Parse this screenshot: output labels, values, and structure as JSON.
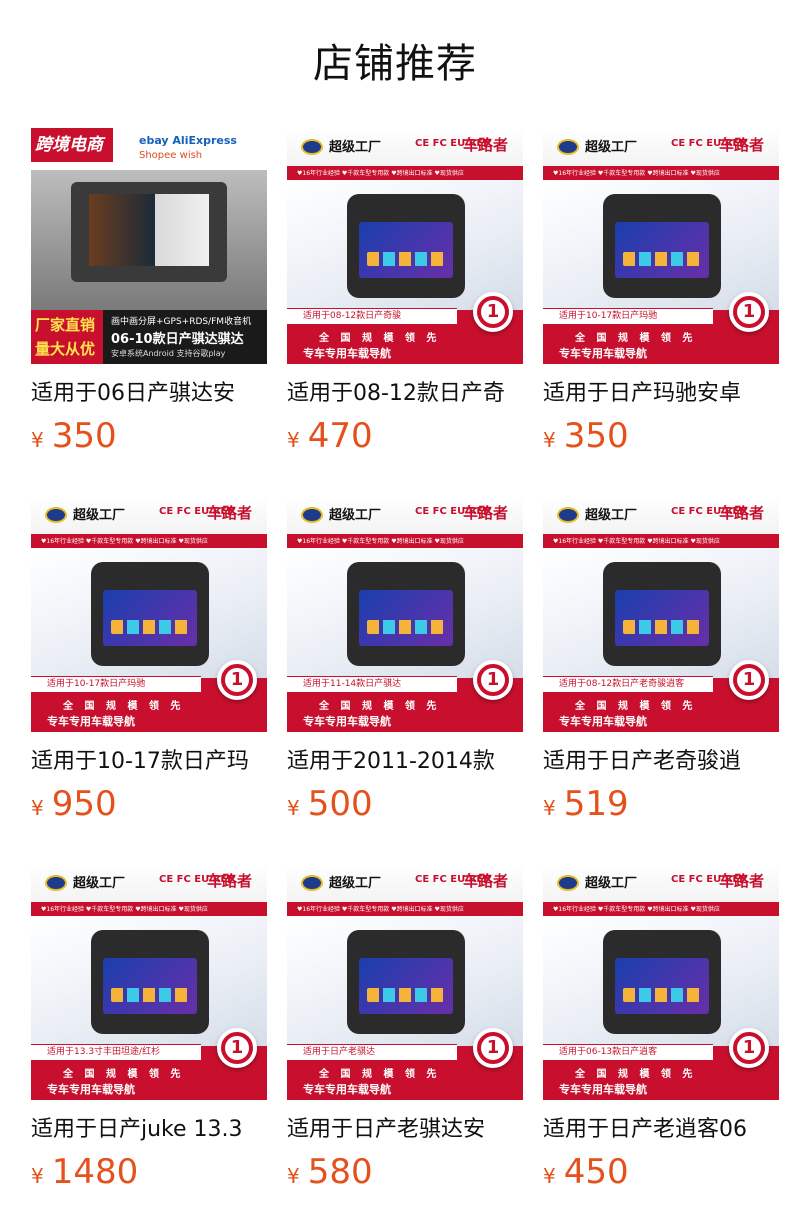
{
  "header": {
    "title": "店铺推荐"
  },
  "currency": "¥",
  "thumb_template": {
    "logo": "超级工厂",
    "certs": "CE FC EU REP",
    "brand": "车路者",
    "features": "♥16年行业经验  ♥千款车型专用款  ♥跨境出口标准  ♥现货供应",
    "slogan1": "全 国 规 模 领 先",
    "slogan2": "专车专用车载导航",
    "pin": "1"
  },
  "first_thumb": {
    "tag": "跨境电商",
    "logos_line1": "ebay  AliExpress",
    "logos_line2": "Shopee  wish",
    "badge": "厂家直销 量大从优",
    "line1": "画中画分屏+GPS+RDS/FM收音机",
    "line2": "06-10款日产骐达骐达",
    "line3": "安卓系统Android 支持谷歌play"
  },
  "products": [
    {
      "name": "适用于06日产骐达安",
      "price": "350",
      "fit": ""
    },
    {
      "name": "适用于08-12款日产奇",
      "price": "470",
      "fit": "适用于08-12款日产奇骏"
    },
    {
      "name": "适用于日产玛驰安卓",
      "price": "350",
      "fit": "适用于10-17款日产玛驰"
    },
    {
      "name": "适用于10-17款日产玛",
      "price": "950",
      "fit": "适用于10-17款日产玛驰"
    },
    {
      "name": "适用于2011-2014款",
      "price": "500",
      "fit": "适用于11-14款日产骐达"
    },
    {
      "name": "适用于日产老奇骏逍",
      "price": "519",
      "fit": "适用于08-12款日产老奇骏逍客"
    },
    {
      "name": "适用于日产juke 13.3",
      "price": "1480",
      "fit": "适用于13.3寸丰田坦途/红杉"
    },
    {
      "name": "适用于日产老骐达安",
      "price": "580",
      "fit": "适用于日产老骐达"
    },
    {
      "name": "适用于日产老逍客06",
      "price": "450",
      "fit": "适用于06-13款日产逍客"
    }
  ]
}
